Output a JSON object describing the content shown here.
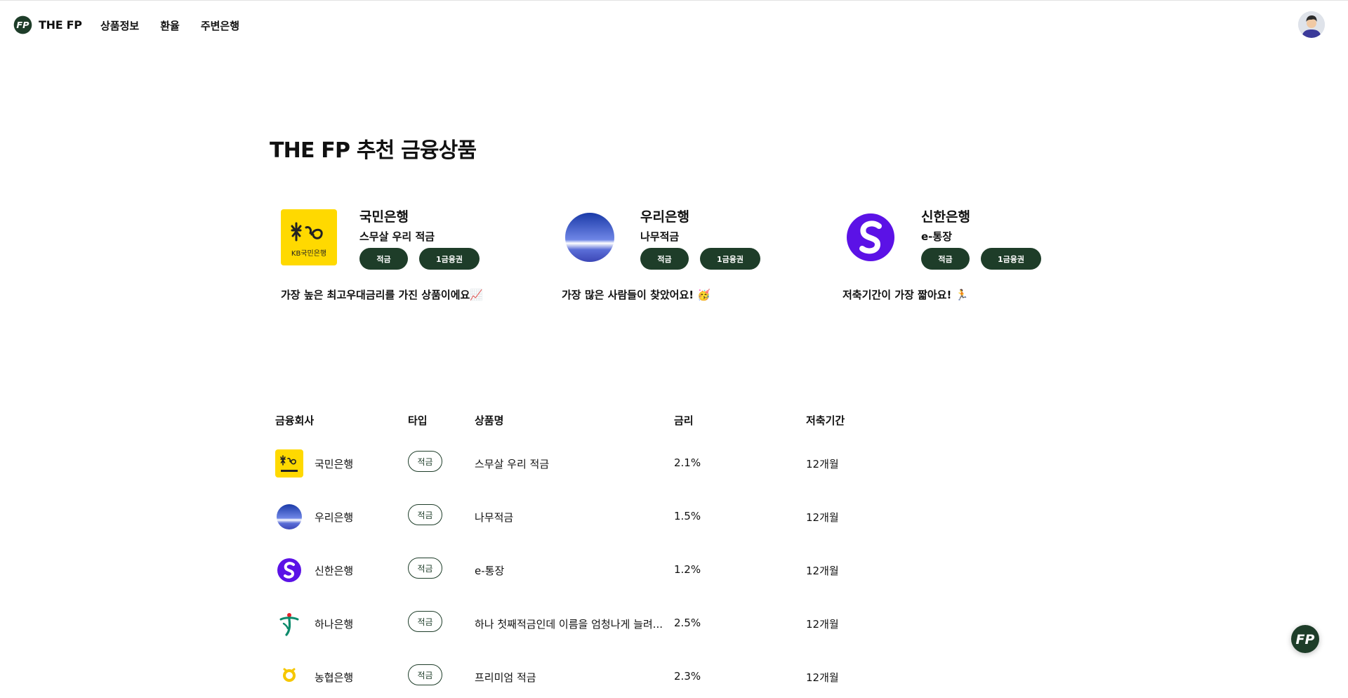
{
  "header": {
    "brand": "THE FP",
    "nav": [
      "상품정보",
      "환율",
      "주변은행"
    ]
  },
  "page_title": "THE FP 추천 금융상품",
  "recommendations": [
    {
      "bank": "국민은행",
      "product": "스무살 우리 적금",
      "tags": [
        "적금",
        "1금융권"
      ],
      "description": "가장 높은 최고우대금리를 가진 상품이에요📈",
      "logo": "kb-logo",
      "logo_text": "KB국민은행"
    },
    {
      "bank": "우리은행",
      "product": "나무적금",
      "tags": [
        "적금",
        "1금융권"
      ],
      "description": "가장 많은 사람들이 찾았어요! 🥳",
      "logo": "woori-logo"
    },
    {
      "bank": "신한은행",
      "product": "e-통장",
      "tags": [
        "적금",
        "1금융권"
      ],
      "description": "저축기간이 가장 짧아요! 🏃",
      "logo": "shinhan-logo"
    }
  ],
  "table": {
    "headers": [
      "금융회사",
      "타입",
      "상품명",
      "금리",
      "저축기간"
    ],
    "rows": [
      {
        "bank": "국민은행",
        "type": "적금",
        "product": "스무살 우리 적금",
        "rate": "2.1%",
        "period": "12개월",
        "logo": "kb-logo"
      },
      {
        "bank": "우리은행",
        "type": "적금",
        "product": "나무적금",
        "rate": "1.5%",
        "period": "12개월",
        "logo": "woori-logo"
      },
      {
        "bank": "신한은행",
        "type": "적금",
        "product": "e-통장",
        "rate": "1.2%",
        "period": "12개월",
        "logo": "shinhan-logo"
      },
      {
        "bank": "하나은행",
        "type": "적금",
        "product": "하나 첫째적금인데 이름을 엄청나게 늘려...",
        "rate": "2.5%",
        "period": "12개월",
        "logo": "hana-logo"
      },
      {
        "bank": "농협은행",
        "type": "적금",
        "product": "프리미엄 적금",
        "rate": "2.3%",
        "period": "12개월",
        "logo": "nh-logo"
      }
    ]
  },
  "colors": {
    "accent": "#1e3d29",
    "kb_yellow": "#ffd900",
    "woori_blue": "#4a5fc9",
    "shinhan_purple": "#5b12e6",
    "hana_green": "#0b8a6b",
    "nh_yellow": "#f6c700"
  }
}
